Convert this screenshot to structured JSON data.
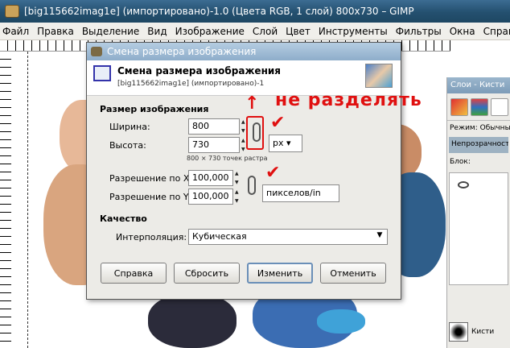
{
  "window": {
    "title": "[big115662imag1e] (импортировано)-1.0 (Цвета RGB, 1 слой) 800x730 – GIMP"
  },
  "menu": [
    "Файл",
    "Правка",
    "Выделение",
    "Вид",
    "Изображение",
    "Слой",
    "Цвет",
    "Инструменты",
    "Фильтры",
    "Окна",
    "Справка"
  ],
  "dock": {
    "title": "Слои - Кисти",
    "mode_label": "Режим:",
    "mode_value": "Обычный",
    "opacity_label": "Непрозрачность",
    "lock_label": "Блок:",
    "brush_label": "Кисти"
  },
  "dialog": {
    "title": "Смена размера изображения",
    "heading": "Смена размера изображения",
    "subheading": "[big115662imag1e] (импортировано)-1",
    "size_section": "Размер изображения",
    "width_label": "Ширина:",
    "width_value": "800",
    "height_label": "Высота:",
    "height_value": "730",
    "size_unit": "px",
    "pixels_note": "800 × 730 точек растра",
    "xres_label": "Разрешение по X:",
    "xres_value": "100,000",
    "yres_label": "Разрешение по Y:",
    "yres_value": "100,000",
    "res_unit": "пикселов/in",
    "quality_section": "Качество",
    "interp_label": "Интерполяция:",
    "interp_value": "Кубическая",
    "buttons": {
      "help": "Справка",
      "reset": "Сбросить",
      "scale": "Изменить",
      "cancel": "Отменить"
    }
  },
  "annotation": {
    "text": "не разделять",
    "color": "#e01010"
  }
}
